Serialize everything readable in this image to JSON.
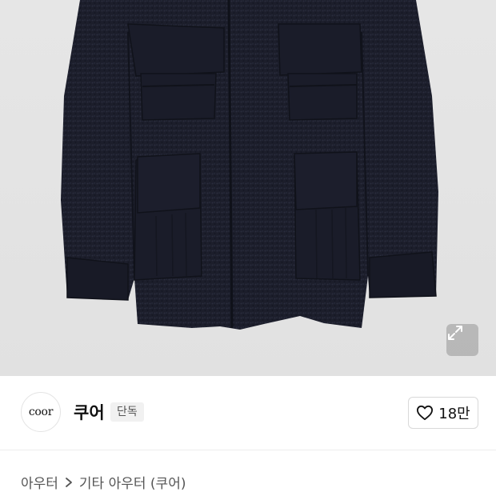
{
  "product": {
    "image_alt_icon": "jacket-photo",
    "expand_icon": "expand-icon"
  },
  "brand": {
    "logo_text": "coor",
    "name": "쿠어",
    "badge": "단독"
  },
  "like": {
    "count": "18만",
    "icon": "heart-icon"
  },
  "breadcrumb": {
    "items": [
      "아우터",
      "기타 아우터 (쿠어)"
    ]
  },
  "colors": {
    "image_bg": "#e3e3e3",
    "jacket": "#1d1f2c",
    "badge_bg": "#f1f1f1"
  }
}
